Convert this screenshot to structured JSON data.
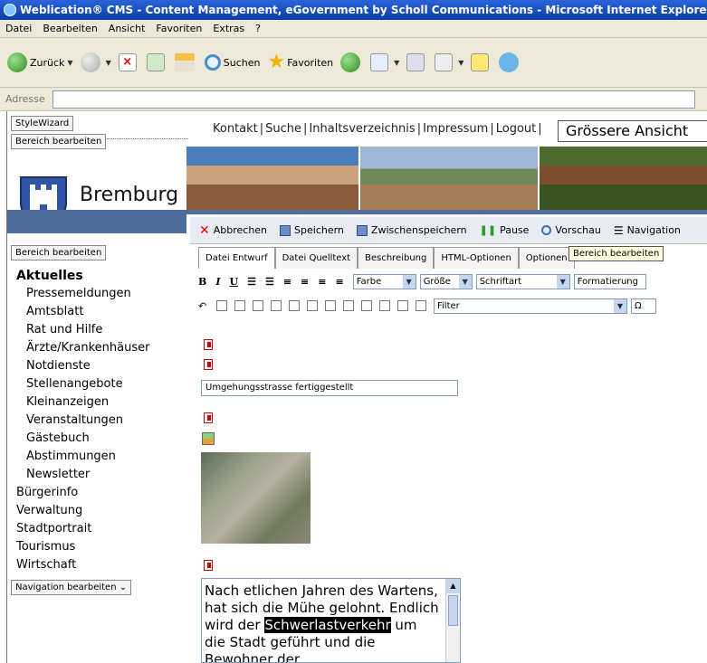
{
  "window": {
    "title": "Weblication® CMS - Content Management, eGovernment by Scholl Communications - Microsoft Internet Explorer"
  },
  "menu": [
    "Datei",
    "Bearbeiten",
    "Ansicht",
    "Favoriten",
    "Extras",
    "?"
  ],
  "toolbar": {
    "back": "Zurück",
    "search": "Suchen",
    "favorites": "Favoriten"
  },
  "address": {
    "label": "Adresse",
    "value": ""
  },
  "page": {
    "stylewizard": "StyleWizard",
    "bereich_top": "Bereich bearbeiten",
    "topnav": [
      "Kontakt",
      "Suche",
      "Inhaltsverzeichnis",
      "Impressum",
      "Logout"
    ],
    "bigbutton": "Grössere Ansicht",
    "logo": "Bremburg",
    "bereich_left": "Bereich bearbeiten",
    "nav_edit": "Navigation bearbeiten"
  },
  "editbar": {
    "cancel": "Abbrechen",
    "save": "Speichern",
    "intermediate": "Zwischenspeichern",
    "pause": "Pause",
    "preview": "Vorschau",
    "navigation": "Navigation"
  },
  "leftnav": [
    {
      "label": "Aktuelles",
      "level": "head"
    },
    {
      "label": "Pressemeldungen",
      "level": "sub"
    },
    {
      "label": "Amtsblatt",
      "level": "sub"
    },
    {
      "label": "Rat und Hilfe",
      "level": "sub"
    },
    {
      "label": "Ärzte/Krankenhäuser",
      "level": "sub"
    },
    {
      "label": "Notdienste",
      "level": "sub"
    },
    {
      "label": "Stellenangebote",
      "level": "sub"
    },
    {
      "label": "Kleinanzeigen",
      "level": "sub"
    },
    {
      "label": "Veranstaltungen",
      "level": "sub"
    },
    {
      "label": "Gästebuch",
      "level": "sub"
    },
    {
      "label": "Abstimmungen",
      "level": "sub"
    },
    {
      "label": "Newsletter",
      "level": "sub"
    },
    {
      "label": "Bürgerinfo",
      "level": "top"
    },
    {
      "label": "Verwaltung",
      "level": "top"
    },
    {
      "label": "Stadtportrait",
      "level": "top"
    },
    {
      "label": "Tourismus",
      "level": "top"
    },
    {
      "label": "Wirtschaft",
      "level": "top"
    }
  ],
  "editor": {
    "tabs": [
      "Datei Entwurf",
      "Datei Quelltext",
      "Beschreibung",
      "HTML-Optionen",
      "Optionen"
    ],
    "tooltip": "Bereich bearbeiten",
    "format": {
      "bold": "B",
      "italic": "I",
      "underline": "U",
      "color": "Farbe",
      "size": "Größe",
      "font": "Schriftart",
      "formatting": "Formatierung",
      "filter": "Filter",
      "omega": "Ω"
    },
    "headline": "Umgehungsstrasse fertiggestellt",
    "text_before": "Nach etlichen Jahren des Wartens, hat sich die Mühe gelohnt. Endlich wird der",
    "text_highlight": "Schwerlastverkehr",
    "text_after": " um die Stadt geführt und die Bewohner der"
  }
}
